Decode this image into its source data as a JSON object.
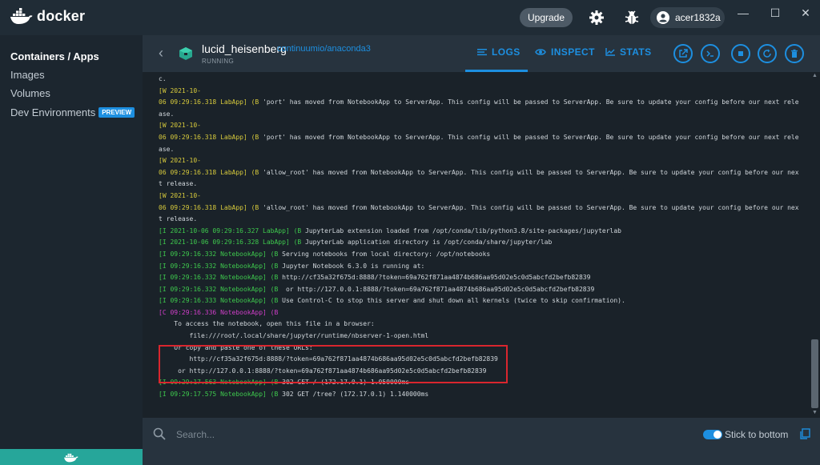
{
  "app": {
    "name": "docker"
  },
  "titlebar": {
    "upgrade_label": "Upgrade",
    "username": "acer1832a",
    "icons": [
      "gear-icon",
      "bug-icon",
      "user-avatar-icon"
    ],
    "window_controls": [
      "minimize",
      "maximize",
      "close"
    ]
  },
  "sidebar": {
    "items": [
      {
        "label": "Containers / Apps",
        "active": true
      },
      {
        "label": "Images"
      },
      {
        "label": "Volumes"
      },
      {
        "label": "Dev Environments",
        "badge": "PREVIEW"
      }
    ]
  },
  "container": {
    "name": "lucid_heisenberg",
    "image": "continuumio/anaconda3",
    "status": "RUNNING"
  },
  "tabs": [
    {
      "label": "LOGS",
      "active": true,
      "icon": "list-icon"
    },
    {
      "label": "INSPECT",
      "icon": "eye-icon"
    },
    {
      "label": "STATS",
      "icon": "chart-line-icon"
    }
  ],
  "actions": [
    "open-in-browser-icon",
    "cli-icon",
    "stop-icon",
    "restart-icon",
    "delete-icon"
  ],
  "logs": [
    {
      "text": "c.",
      "color": "default"
    },
    {
      "text": "[W 2021-10-",
      "color": "yellow"
    },
    {
      "text": "06 09:29:16.318 LabApp] (B 'port' has moved from NotebookApp to ServerApp. This config will be passed to ServerApp. Be sure to update your config before our next rele",
      "color": "mixed-yellow"
    },
    {
      "text": "ase.",
      "color": "default"
    },
    {
      "text": "[W 2021-10-",
      "color": "yellow"
    },
    {
      "text": "06 09:29:16.318 LabApp] (B 'port' has moved from NotebookApp to ServerApp. This config will be passed to ServerApp. Be sure to update your config before our next rele",
      "color": "mixed-yellow"
    },
    {
      "text": "ase.",
      "color": "default"
    },
    {
      "text": "[W 2021-10-",
      "color": "yellow"
    },
    {
      "text": "06 09:29:16.318 LabApp] (B 'allow_root' has moved from NotebookApp to ServerApp. This config will be passed to ServerApp. Be sure to update your config before our nex",
      "color": "mixed-yellow"
    },
    {
      "text": "t release.",
      "color": "default"
    },
    {
      "text": "[W 2021-10-",
      "color": "yellow"
    },
    {
      "text": "06 09:29:16.318 LabApp] (B 'allow_root' has moved from NotebookApp to ServerApp. This config will be passed to ServerApp. Be sure to update your config before our nex",
      "color": "mixed-yellow"
    },
    {
      "text": "t release.",
      "color": "default"
    },
    {
      "text": "[I 2021-10-06 09:29:16.327 LabApp] (B JupyterLab extension loaded from /opt/conda/lib/python3.8/site-packages/jupyterlab",
      "color": "mixed-green"
    },
    {
      "text": "[I 2021-10-06 09:29:16.328 LabApp] (B JupyterLab application directory is /opt/conda/share/jupyter/lab",
      "color": "mixed-green"
    },
    {
      "text": "[I 09:29:16.332 NotebookApp] (B Serving notebooks from local directory: /opt/notebooks",
      "color": "mixed-green"
    },
    {
      "text": "[I 09:29:16.332 NotebookApp] (B Jupyter Notebook 6.3.0 is running at:",
      "color": "mixed-green"
    },
    {
      "text": "[I 09:29:16.332 NotebookApp] (B http://cf35a32f675d:8888/?token=69a762f871aa4874b686aa95d02e5c0d5abcfd2befb82839",
      "color": "mixed-green"
    },
    {
      "text": "[I 09:29:16.332 NotebookApp] (B  or http://127.0.0.1:8888/?token=69a762f871aa4874b686aa95d02e5c0d5abcfd2befb82839",
      "color": "mixed-green"
    },
    {
      "text": "[I 09:29:16.333 NotebookApp] (B Use Control-C to stop this server and shut down all kernels (twice to skip confirmation).",
      "color": "mixed-green"
    },
    {
      "text": "[C 09:29:16.336 NotebookApp] (B",
      "color": "magenta"
    },
    {
      "text": "",
      "color": "default"
    },
    {
      "text": "    To access the notebook, open this file in a browser:",
      "color": "default"
    },
    {
      "text": "        file:///root/.local/share/jupyter/runtime/nbserver-1-open.html",
      "color": "default"
    },
    {
      "text": "    Or copy and paste one of these URLs:",
      "color": "default"
    },
    {
      "text": "        http://cf35a32f675d:8888/?token=69a762f871aa4874b686aa95d02e5c0d5abcfd2befb82839",
      "color": "default"
    },
    {
      "text": "     or http://127.0.0.1:8888/?token=69a762f871aa4874b686aa95d02e5c0d5abcfd2befb82839",
      "color": "default"
    },
    {
      "text": "[I 09:29:17.563 NotebookApp] (B 302 GET / (172.17.0.1) 1.050000ms",
      "color": "mixed-green"
    },
    {
      "text": "[I 09:29:17.575 NotebookApp] (B 302 GET /tree? (172.17.0.1) 1.140000ms",
      "color": "mixed-green"
    }
  ],
  "footer": {
    "search_placeholder": "Search...",
    "stick_label": "Stick to bottom",
    "stick_enabled": true
  },
  "colors": {
    "accent": "#1d8fe0",
    "log_yellow": "#d7ca3c",
    "log_green": "#3ec94d",
    "log_magenta": "#d03ec9",
    "highlight_box": "#d9262e",
    "sidebar_bottom": "#26a69a"
  }
}
